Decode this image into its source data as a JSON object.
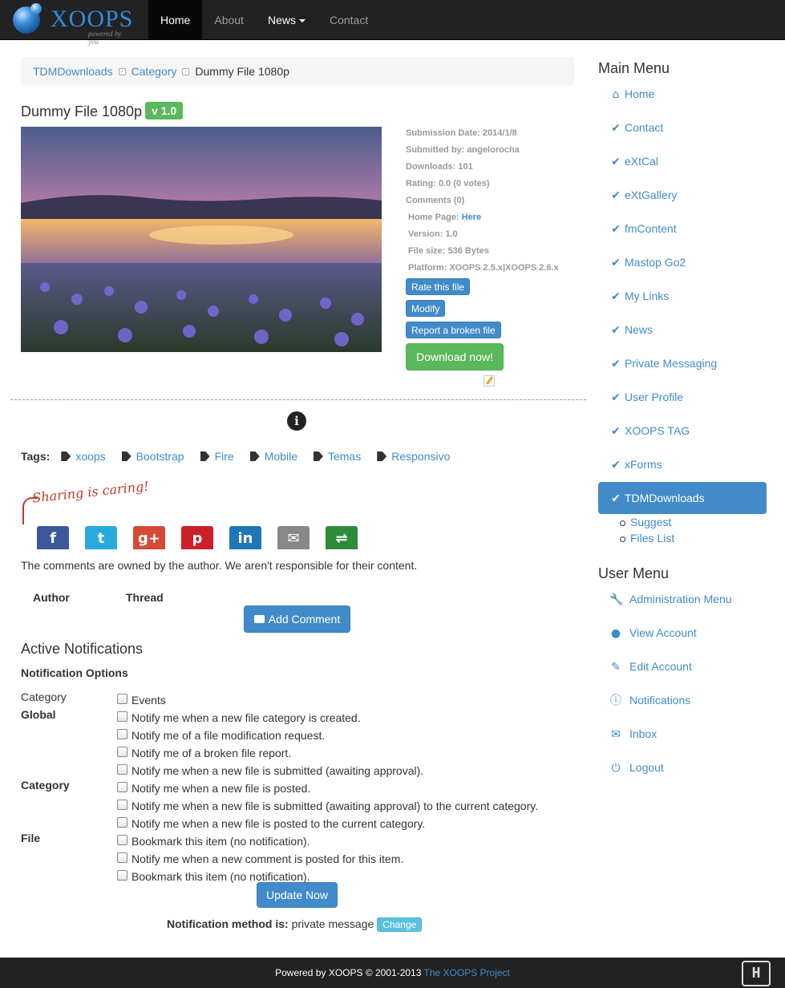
{
  "brand": {
    "name": "XOOPS",
    "tagline": "powered by you"
  },
  "nav": {
    "home": "Home",
    "about": "About",
    "news": "News",
    "contact": "Contact"
  },
  "breadcrumb": {
    "root": "TDMDownloads",
    "category": "Category",
    "current": "Dummy File 1080p"
  },
  "file": {
    "title": "Dummy File 1080p",
    "version_badge": "v 1.0",
    "submission_date": "Submission Date: 2014/1/8",
    "submitted_by": "Submitted by: angelorocha",
    "downloads": "Downloads: 101",
    "rating": "Rating: 0.0 (0 votes)",
    "comments": "Comments (0)",
    "homepage_label": "Home Page:",
    "homepage_link": "Here",
    "version": "Version: 1.0",
    "file_size": "File size: 536 Bytes",
    "platform": "Platform: XOOPS 2.5.x|XOOPS 2.6.x"
  },
  "actions": {
    "rate": "Rate this file",
    "modify": "Modify",
    "report": "Report a broken file",
    "download": "Download now!"
  },
  "tags": {
    "label": "Tags:",
    "items": [
      "xoops",
      "Bootstrap",
      "Fire",
      "Mobile",
      "Temas",
      "Responsivo"
    ]
  },
  "sharing": {
    "caption": "Sharing is caring!",
    "buttons": [
      {
        "name": "facebook",
        "glyph": "f",
        "color": "#3b5998"
      },
      {
        "name": "twitter",
        "glyph": "t",
        "color": "#2aa9e0"
      },
      {
        "name": "googleplus",
        "glyph": "g+",
        "color": "#d64937"
      },
      {
        "name": "pinterest",
        "glyph": "p",
        "color": "#cb2027"
      },
      {
        "name": "linkedin",
        "glyph": "in",
        "color": "#1f77b5"
      },
      {
        "name": "email",
        "glyph": "✉",
        "color": "#888888"
      },
      {
        "name": "sharethis",
        "glyph": "⇌",
        "color": "#2e8b3a"
      }
    ]
  },
  "comments": {
    "disclaimer": "The comments are owned by the author. We aren't responsible for their content.",
    "author_header": "Author",
    "thread_header": "Thread",
    "add_button": "Add Comment"
  },
  "notifications": {
    "heading": "Active Notifications",
    "options_heading": "Notification Options",
    "category_label": "Category",
    "groups": [
      {
        "label": "Global",
        "items": [
          "Events",
          "Notify me when a new file category is created.",
          "Notify me of a file modification request.",
          "Notify me of a broken file report.",
          "Notify me when a new file is submitted (awaiting approval)."
        ]
      },
      {
        "label": "Category",
        "items": [
          "Notify me when a new file is posted.",
          "Notify me when a new file is submitted (awaiting approval) to the current category.",
          "Notify me when a new file is posted to the current category."
        ]
      },
      {
        "label": "File",
        "items": [
          "Bookmark this item (no notification).",
          "Notify me when a new comment is posted for this item.",
          "Bookmark this item (no notification)."
        ]
      }
    ],
    "update_button": "Update Now",
    "method_label": "Notification method is:",
    "method_value": "private message",
    "change_button": "Change"
  },
  "main_menu": {
    "heading": "Main Menu",
    "items": [
      "Home",
      "Contact",
      "eXtCal",
      "eXtGallery",
      "fmContent",
      "Mastop Go2",
      "My Links",
      "News",
      "Private Messaging",
      "User Profile",
      "XOOPS TAG",
      "xForms",
      "TDMDownloads"
    ],
    "sub_items": [
      "Suggest",
      "Files List"
    ]
  },
  "user_menu": {
    "heading": "User Menu",
    "items": [
      "Administration Menu",
      "View Account",
      "Edit Account",
      "Notifications",
      "Inbox",
      "Logout"
    ]
  },
  "footer": {
    "text": "Powered by XOOPS © 2001-2013",
    "link": "The XOOPS Project",
    "logo_glyph": "H"
  }
}
